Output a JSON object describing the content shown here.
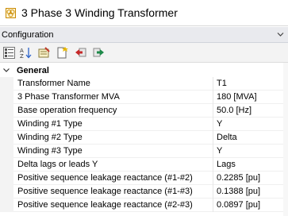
{
  "window": {
    "title": "3 Phase 3 Winding Transformer",
    "icon": "transformer-icon"
  },
  "panel": {
    "header": "Configuration"
  },
  "toolbar": {
    "buttons": [
      {
        "icon": "categorized-view-icon"
      },
      {
        "icon": "alphabetical-sort-icon"
      },
      {
        "icon": "properties-edit-icon"
      },
      {
        "icon": "new-page-icon"
      },
      {
        "icon": "back-arrow-icon"
      },
      {
        "icon": "forward-arrow-icon"
      }
    ]
  },
  "grid": {
    "category": "General",
    "rows": [
      {
        "name": "Transformer Name",
        "value": "T1"
      },
      {
        "name": "3 Phase Transformer MVA",
        "value": "180 [MVA]"
      },
      {
        "name": "Base operation frequency",
        "value": "50.0 [Hz]"
      },
      {
        "name": "Winding #1 Type",
        "value": "Y"
      },
      {
        "name": "Winding #2 Type",
        "value": "Delta"
      },
      {
        "name": "Winding #3 Type",
        "value": "Y"
      },
      {
        "name": "Delta lags or leads Y",
        "value": "Lags"
      },
      {
        "name": "Positive sequence leakage reactance (#1-#2)",
        "value": "0.2285 [pu]"
      },
      {
        "name": "Positive sequence leakage reactance (#1-#3)",
        "value": "0.1388 [pu]"
      },
      {
        "name": "Positive sequence leakage reactance (#2-#3)",
        "value": "0.0897 [pu]"
      }
    ]
  }
}
